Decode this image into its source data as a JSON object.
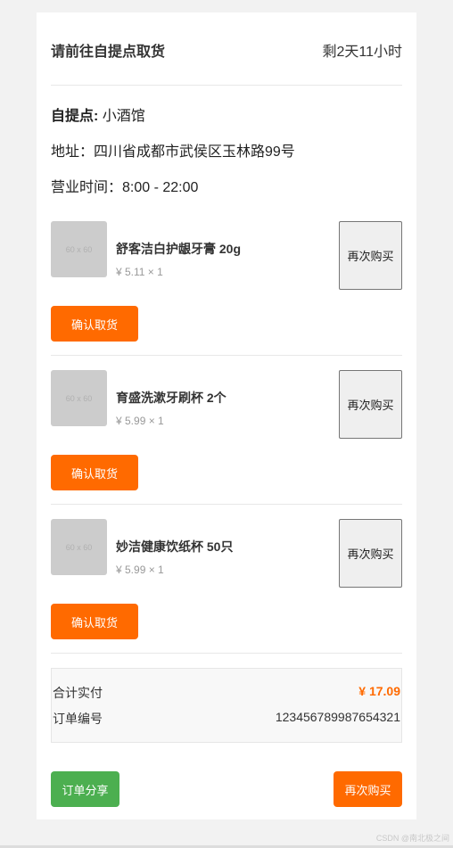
{
  "header": {
    "title": "请前往自提点取货",
    "time_left": "剩2天11小时"
  },
  "store": {
    "name_label": "自提点:",
    "name": "小酒馆",
    "address": "地址：四川省成都市武侯区玉林路99号",
    "hours": "营业时间：8:00 - 22:00"
  },
  "items": [
    {
      "thumb_text": "60 x 60",
      "name": "舒客洁白护龈牙膏 20g",
      "price": "¥ 5.11 × 1",
      "rebuy_label": "再次购买",
      "confirm_label": "确认取货"
    },
    {
      "thumb_text": "60 x 60",
      "name": "育盛洗漱牙刷杯 2个",
      "price": "¥ 5.99 × 1",
      "rebuy_label": "再次购买",
      "confirm_label": "确认取货"
    },
    {
      "thumb_text": "60 x 60",
      "name": "妙洁健康饮纸杯 50只",
      "price": "¥ 5.99 × 1",
      "rebuy_label": "再次购买",
      "confirm_label": "确认取货"
    }
  ],
  "summary": {
    "total_label": "合计实付",
    "total_value": "¥ 17.09",
    "order_label": "订单编号",
    "order_value": "123456789987654321"
  },
  "actions": {
    "share_label": "订单分享",
    "rebuy_label": "再次购买"
  },
  "watermark": "CSDN @南北极之间",
  "colors": {
    "accent": "#ff6a00",
    "share": "#4caf50"
  }
}
